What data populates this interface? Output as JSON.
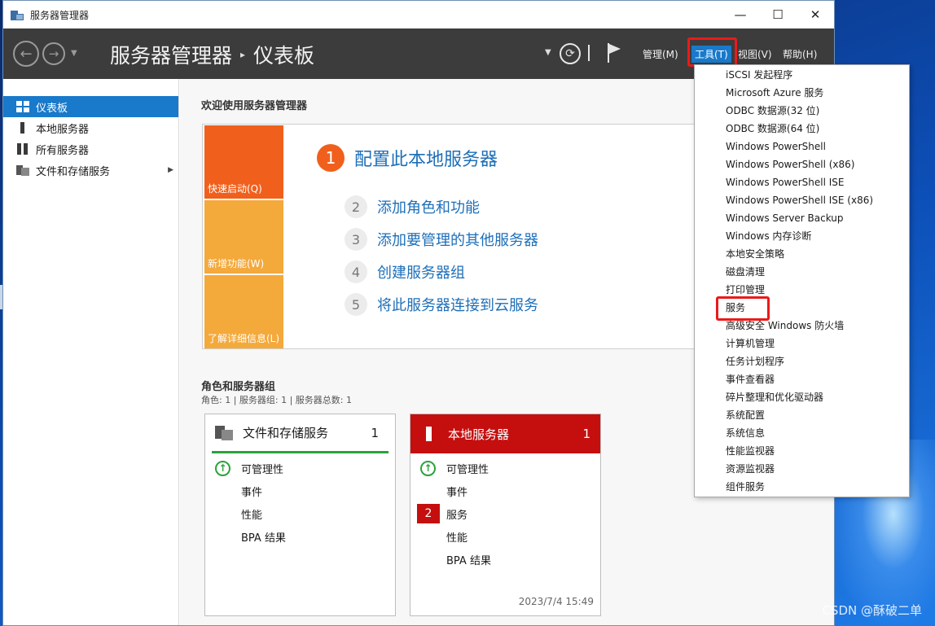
{
  "window": {
    "title": "服务器管理器",
    "controls": {
      "minimize": "—",
      "maximize": "☐",
      "close": "✕"
    }
  },
  "toolbar": {
    "breadcrumb_root": "服务器管理器",
    "breadcrumb_sep": "▸",
    "breadcrumb_current": "仪表板",
    "menus": {
      "manage": "管理(M)",
      "tools": "工具(T)",
      "view": "视图(V)",
      "help": "帮助(H)"
    }
  },
  "sidebar": {
    "items": [
      {
        "label": "仪表板",
        "icon": "dashboard-icon",
        "selected": true
      },
      {
        "label": "本地服务器",
        "icon": "server-icon"
      },
      {
        "label": "所有服务器",
        "icon": "servers-icon"
      },
      {
        "label": "文件和存储服务",
        "icon": "file-storage-icon",
        "has_children": true
      }
    ]
  },
  "main": {
    "welcome_title": "欢迎使用服务器管理器",
    "tiles": [
      {
        "label": "快速启动(Q)",
        "color": "#f0601c"
      },
      {
        "label": "新增功能(W)",
        "color": "#f4a93b"
      },
      {
        "label": "了解详细信息(L)",
        "color": "#f4a93b"
      }
    ],
    "steps": [
      {
        "num": "1",
        "label": "配置此本地服务器"
      },
      {
        "num": "2",
        "label": "添加角色和功能"
      },
      {
        "num": "3",
        "label": "添加要管理的其他服务器"
      },
      {
        "num": "4",
        "label": "创建服务器组"
      },
      {
        "num": "5",
        "label": "将此服务器连接到云服务"
      }
    ],
    "roles_title": "角色和服务器组",
    "roles_sub": "角色: 1 | 服务器组: 1 | 服务器总数: 1",
    "cards": [
      {
        "title": "文件和存储服务",
        "count": "1",
        "status": "ok",
        "rows": [
          "可管理性",
          "事件",
          "性能",
          "BPA 结果"
        ]
      },
      {
        "title": "本地服务器",
        "count": "1",
        "status": "alert",
        "rows": [
          "可管理性",
          "事件",
          "服务",
          "性能",
          "BPA 结果"
        ],
        "services_badge": "2",
        "timestamp": "2023/7/4 15:49"
      }
    ]
  },
  "tools_menu": {
    "items": [
      "iSCSI 发起程序",
      "Microsoft Azure 服务",
      "ODBC 数据源(32 位)",
      "ODBC 数据源(64 位)",
      "Windows PowerShell",
      "Windows PowerShell (x86)",
      "Windows PowerShell ISE",
      "Windows PowerShell ISE (x86)",
      "Windows Server Backup",
      "Windows 内存诊断",
      "本地安全策略",
      "磁盘清理",
      "打印管理",
      "服务",
      "高级安全 Windows 防火墙",
      "计算机管理",
      "任务计划程序",
      "事件查看器",
      "碎片整理和优化驱动器",
      "系统配置",
      "系统信息",
      "性能监视器",
      "资源监视器",
      "组件服务"
    ]
  },
  "watermark": "CSDN @酥破二单",
  "colors": {
    "accent": "#1979ca",
    "highlight": "#ea1a1a",
    "alert": "#c50f0f",
    "ok": "#2aa33a"
  }
}
